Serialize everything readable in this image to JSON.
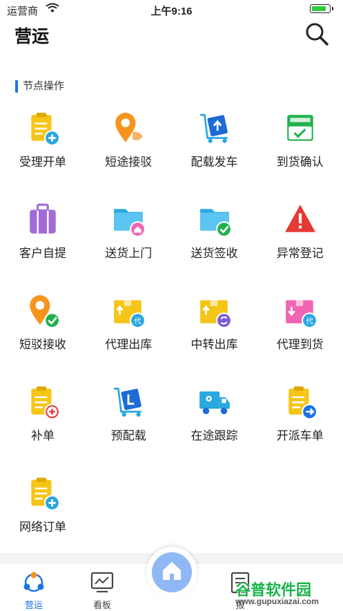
{
  "status_bar": {
    "carrier": "运营商",
    "time": "上午9:16",
    "battery_level": 0.9
  },
  "header": {
    "title": "营运",
    "search_icon": "search-icon"
  },
  "section": {
    "title": "节点操作"
  },
  "tiles": [
    {
      "label": "受理开单",
      "icon": "doc-add-icon"
    },
    {
      "label": "短途接驳",
      "icon": "pin-handoff-icon"
    },
    {
      "label": "配载发车",
      "icon": "cart-upload-icon"
    },
    {
      "label": "到货确认",
      "icon": "inbox-check-icon"
    },
    {
      "label": "客户自提",
      "icon": "suitcase-icon"
    },
    {
      "label": "送货上门",
      "icon": "folder-home-icon"
    },
    {
      "label": "送货签收",
      "icon": "folder-check-icon"
    },
    {
      "label": "异常登记",
      "icon": "warning-icon"
    },
    {
      "label": "短驳接收",
      "icon": "pin-check-icon"
    },
    {
      "label": "代理出库",
      "icon": "box-agent-out-icon"
    },
    {
      "label": "中转出库",
      "icon": "box-transfer-icon"
    },
    {
      "label": "代理到货",
      "icon": "box-agent-in-icon"
    },
    {
      "label": "补单",
      "icon": "doc-plus-icon"
    },
    {
      "label": "预配载",
      "icon": "cart-preload-icon"
    },
    {
      "label": "在途跟踪",
      "icon": "truck-icon"
    },
    {
      "label": "开派车单",
      "icon": "doc-arrow-icon"
    },
    {
      "label": "网络订单",
      "icon": "doc-add-icon"
    }
  ],
  "tabbar": {
    "tabs": [
      {
        "label": "营运",
        "icon": "operations-icon",
        "active": true
      },
      {
        "label": "看板",
        "icon": "dashboard-icon",
        "active": false
      },
      {
        "label": "报",
        "icon": "report-icon",
        "active": false
      }
    ],
    "center_icon": "home-icon"
  },
  "watermark": {
    "title": "谷普软件园",
    "url": "www.gupuxiazai.com"
  },
  "colors": {
    "accent": "#1a73e8",
    "orange": "#f7941d",
    "yellow": "#f5c518",
    "blue": "#29a8e0",
    "green": "#22b14c",
    "red": "#e53935",
    "purple": "#a06bd6",
    "pink": "#f064b4"
  }
}
